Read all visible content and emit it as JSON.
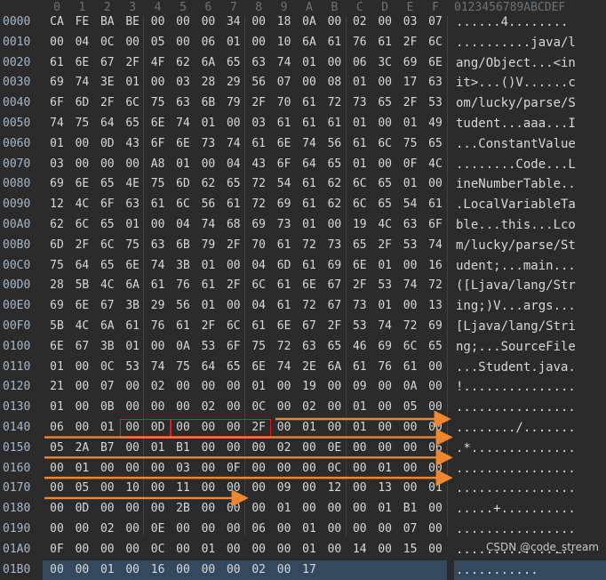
{
  "header": {
    "columns": [
      "0",
      "1",
      "2",
      "3",
      "4",
      "5",
      "6",
      "7",
      "8",
      "9",
      "A",
      "B",
      "C",
      "D",
      "E",
      "F"
    ],
    "ascii_header": "0123456789ABCDEF"
  },
  "rows": [
    {
      "addr": "0000",
      "bytes": [
        "CA",
        "FE",
        "BA",
        "BE",
        "00",
        "00",
        "00",
        "34",
        "00",
        "18",
        "0A",
        "00",
        "02",
        "00",
        "03",
        "07"
      ],
      "ascii": "......4........"
    },
    {
      "addr": "0010",
      "bytes": [
        "00",
        "04",
        "0C",
        "00",
        "05",
        "00",
        "06",
        "01",
        "00",
        "10",
        "6A",
        "61",
        "76",
        "61",
        "2F",
        "6C"
      ],
      "ascii": "..........java/l"
    },
    {
      "addr": "0020",
      "bytes": [
        "61",
        "6E",
        "67",
        "2F",
        "4F",
        "62",
        "6A",
        "65",
        "63",
        "74",
        "01",
        "00",
        "06",
        "3C",
        "69",
        "6E"
      ],
      "ascii": "ang/Object...<in"
    },
    {
      "addr": "0030",
      "bytes": [
        "69",
        "74",
        "3E",
        "01",
        "00",
        "03",
        "28",
        "29",
        "56",
        "07",
        "00",
        "08",
        "01",
        "00",
        "17",
        "63"
      ],
      "ascii": "it>...()V......c"
    },
    {
      "addr": "0040",
      "bytes": [
        "6F",
        "6D",
        "2F",
        "6C",
        "75",
        "63",
        "6B",
        "79",
        "2F",
        "70",
        "61",
        "72",
        "73",
        "65",
        "2F",
        "53"
      ],
      "ascii": "om/lucky/parse/S"
    },
    {
      "addr": "0050",
      "bytes": [
        "74",
        "75",
        "64",
        "65",
        "6E",
        "74",
        "01",
        "00",
        "03",
        "61",
        "61",
        "61",
        "01",
        "00",
        "01",
        "49"
      ],
      "ascii": "tudent...aaa...I"
    },
    {
      "addr": "0060",
      "bytes": [
        "01",
        "00",
        "0D",
        "43",
        "6F",
        "6E",
        "73",
        "74",
        "61",
        "6E",
        "74",
        "56",
        "61",
        "6C",
        "75",
        "65"
      ],
      "ascii": "...ConstantValue"
    },
    {
      "addr": "0070",
      "bytes": [
        "03",
        "00",
        "00",
        "00",
        "A8",
        "01",
        "00",
        "04",
        "43",
        "6F",
        "64",
        "65",
        "01",
        "00",
        "0F",
        "4C"
      ],
      "ascii": "........Code...L"
    },
    {
      "addr": "0080",
      "bytes": [
        "69",
        "6E",
        "65",
        "4E",
        "75",
        "6D",
        "62",
        "65",
        "72",
        "54",
        "61",
        "62",
        "6C",
        "65",
        "01",
        "00"
      ],
      "ascii": "ineNumberTable.."
    },
    {
      "addr": "0090",
      "bytes": [
        "12",
        "4C",
        "6F",
        "63",
        "61",
        "6C",
        "56",
        "61",
        "72",
        "69",
        "61",
        "62",
        "6C",
        "65",
        "54",
        "61"
      ],
      "ascii": ".LocalVariableTa"
    },
    {
      "addr": "00A0",
      "bytes": [
        "62",
        "6C",
        "65",
        "01",
        "00",
        "04",
        "74",
        "68",
        "69",
        "73",
        "01",
        "00",
        "19",
        "4C",
        "63",
        "6F"
      ],
      "ascii": "ble...this...Lco"
    },
    {
      "addr": "00B0",
      "bytes": [
        "6D",
        "2F",
        "6C",
        "75",
        "63",
        "6B",
        "79",
        "2F",
        "70",
        "61",
        "72",
        "73",
        "65",
        "2F",
        "53",
        "74"
      ],
      "ascii": "m/lucky/parse/St"
    },
    {
      "addr": "00C0",
      "bytes": [
        "75",
        "64",
        "65",
        "6E",
        "74",
        "3B",
        "01",
        "00",
        "04",
        "6D",
        "61",
        "69",
        "6E",
        "01",
        "00",
        "16"
      ],
      "ascii": "udent;...main..."
    },
    {
      "addr": "00D0",
      "bytes": [
        "28",
        "5B",
        "4C",
        "6A",
        "61",
        "76",
        "61",
        "2F",
        "6C",
        "61",
        "6E",
        "67",
        "2F",
        "53",
        "74",
        "72"
      ],
      "ascii": "([Ljava/lang/Str"
    },
    {
      "addr": "00E0",
      "bytes": [
        "69",
        "6E",
        "67",
        "3B",
        "29",
        "56",
        "01",
        "00",
        "04",
        "61",
        "72",
        "67",
        "73",
        "01",
        "00",
        "13"
      ],
      "ascii": "ing;)V...args..."
    },
    {
      "addr": "00F0",
      "bytes": [
        "5B",
        "4C",
        "6A",
        "61",
        "76",
        "61",
        "2F",
        "6C",
        "61",
        "6E",
        "67",
        "2F",
        "53",
        "74",
        "72",
        "69"
      ],
      "ascii": "[Ljava/lang/Stri"
    },
    {
      "addr": "0100",
      "bytes": [
        "6E",
        "67",
        "3B",
        "01",
        "00",
        "0A",
        "53",
        "6F",
        "75",
        "72",
        "63",
        "65",
        "46",
        "69",
        "6C",
        "65"
      ],
      "ascii": "ng;...SourceFile"
    },
    {
      "addr": "0110",
      "bytes": [
        "01",
        "00",
        "0C",
        "53",
        "74",
        "75",
        "64",
        "65",
        "6E",
        "74",
        "2E",
        "6A",
        "61",
        "76",
        "61",
        "00"
      ],
      "ascii": "...Student.java."
    },
    {
      "addr": "0120",
      "bytes": [
        "21",
        "00",
        "07",
        "00",
        "02",
        "00",
        "00",
        "00",
        "01",
        "00",
        "19",
        "00",
        "09",
        "00",
        "0A",
        "00"
      ],
      "ascii": "!..............."
    },
    {
      "addr": "0130",
      "bytes": [
        "01",
        "00",
        "0B",
        "00",
        "00",
        "00",
        "02",
        "00",
        "0C",
        "00",
        "02",
        "00",
        "01",
        "00",
        "05",
        "00"
      ],
      "ascii": "................"
    },
    {
      "addr": "0140",
      "bytes": [
        "06",
        "00",
        "01",
        "00",
        "0D",
        "00",
        "00",
        "00",
        "2F",
        "00",
        "01",
        "00",
        "01",
        "00",
        "00",
        "00"
      ],
      "ascii": "......../......."
    },
    {
      "addr": "0150",
      "bytes": [
        "05",
        "2A",
        "B7",
        "00",
        "01",
        "B1",
        "00",
        "00",
        "00",
        "02",
        "00",
        "0E",
        "00",
        "00",
        "00",
        "06"
      ],
      "ascii": ".*.............."
    },
    {
      "addr": "0160",
      "bytes": [
        "00",
        "01",
        "00",
        "00",
        "00",
        "03",
        "00",
        "0F",
        "00",
        "00",
        "00",
        "0C",
        "00",
        "01",
        "00",
        "00"
      ],
      "ascii": "................"
    },
    {
      "addr": "0170",
      "bytes": [
        "00",
        "05",
        "00",
        "10",
        "00",
        "11",
        "00",
        "00",
        "00",
        "09",
        "00",
        "12",
        "00",
        "13",
        "00",
        "01"
      ],
      "ascii": "................"
    },
    {
      "addr": "0180",
      "bytes": [
        "00",
        "0D",
        "00",
        "00",
        "00",
        "2B",
        "00",
        "00",
        "00",
        "01",
        "00",
        "00",
        "00",
        "01",
        "B1",
        "00"
      ],
      "ascii": ".....+.........."
    },
    {
      "addr": "0190",
      "bytes": [
        "00",
        "00",
        "02",
        "00",
        "0E",
        "00",
        "00",
        "00",
        "06",
        "00",
        "01",
        "00",
        "00",
        "00",
        "07",
        "00"
      ],
      "ascii": "................"
    },
    {
      "addr": "01A0",
      "bytes": [
        "0F",
        "00",
        "00",
        "00",
        "0C",
        "00",
        "01",
        "00",
        "00",
        "00",
        "01",
        "00",
        "14",
        "00",
        "15",
        "00"
      ],
      "ascii": "................"
    },
    {
      "addr": "01B0",
      "bytes": [
        "00",
        "00",
        "01",
        "00",
        "16",
        "00",
        "00",
        "00",
        "02",
        "00",
        "17"
      ],
      "ascii": "..........."
    }
  ],
  "watermark": "CSDN @code_stream",
  "colors": {
    "background": "#2b2b2b",
    "byte_text": "#d6d8da",
    "header_text": "#6e7378",
    "highlight_box": "#e01b24",
    "arrow": "#f0862d",
    "selected_row": "#34495e"
  }
}
